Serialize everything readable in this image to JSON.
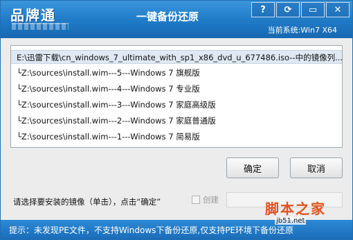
{
  "window": {
    "logo": "品牌通",
    "title": "一键备份还原",
    "system_info": "当前系统:Win7 X64",
    "buttons": {
      "help": "?",
      "refresh": "⟳",
      "minimize": "▭",
      "close": "✕"
    }
  },
  "image_list": {
    "parent": "E:\\迅雷下载\\cn_windows_7_ultimate_with_sp1_x86_dvd_u_677486.iso--中的镜像列...",
    "items": [
      "└Z:\\sources\\install.wim---5---Windows 7 旗舰版",
      "└Z:\\sources\\install.wim---4---Windows 7 专业版",
      "└Z:\\sources\\install.wim---3---Windows 7 家庭高级版",
      "└Z:\\sources\\install.wim---2---Windows 7 家庭普通版",
      "└Z:\\sources\\install.wim---1---Windows 7 简易版"
    ]
  },
  "actions": {
    "ok": "确定",
    "cancel": "取消"
  },
  "hint": "请选择要安装的镜像（单击），点击“确定”",
  "checkbox_label": "创建",
  "footer": "提示：未发现PE文件，不支持Windows下备份还原,仅支持PE环境下备份还原",
  "watermark": {
    "text": "脚本之家",
    "url": "jb51.net"
  }
}
